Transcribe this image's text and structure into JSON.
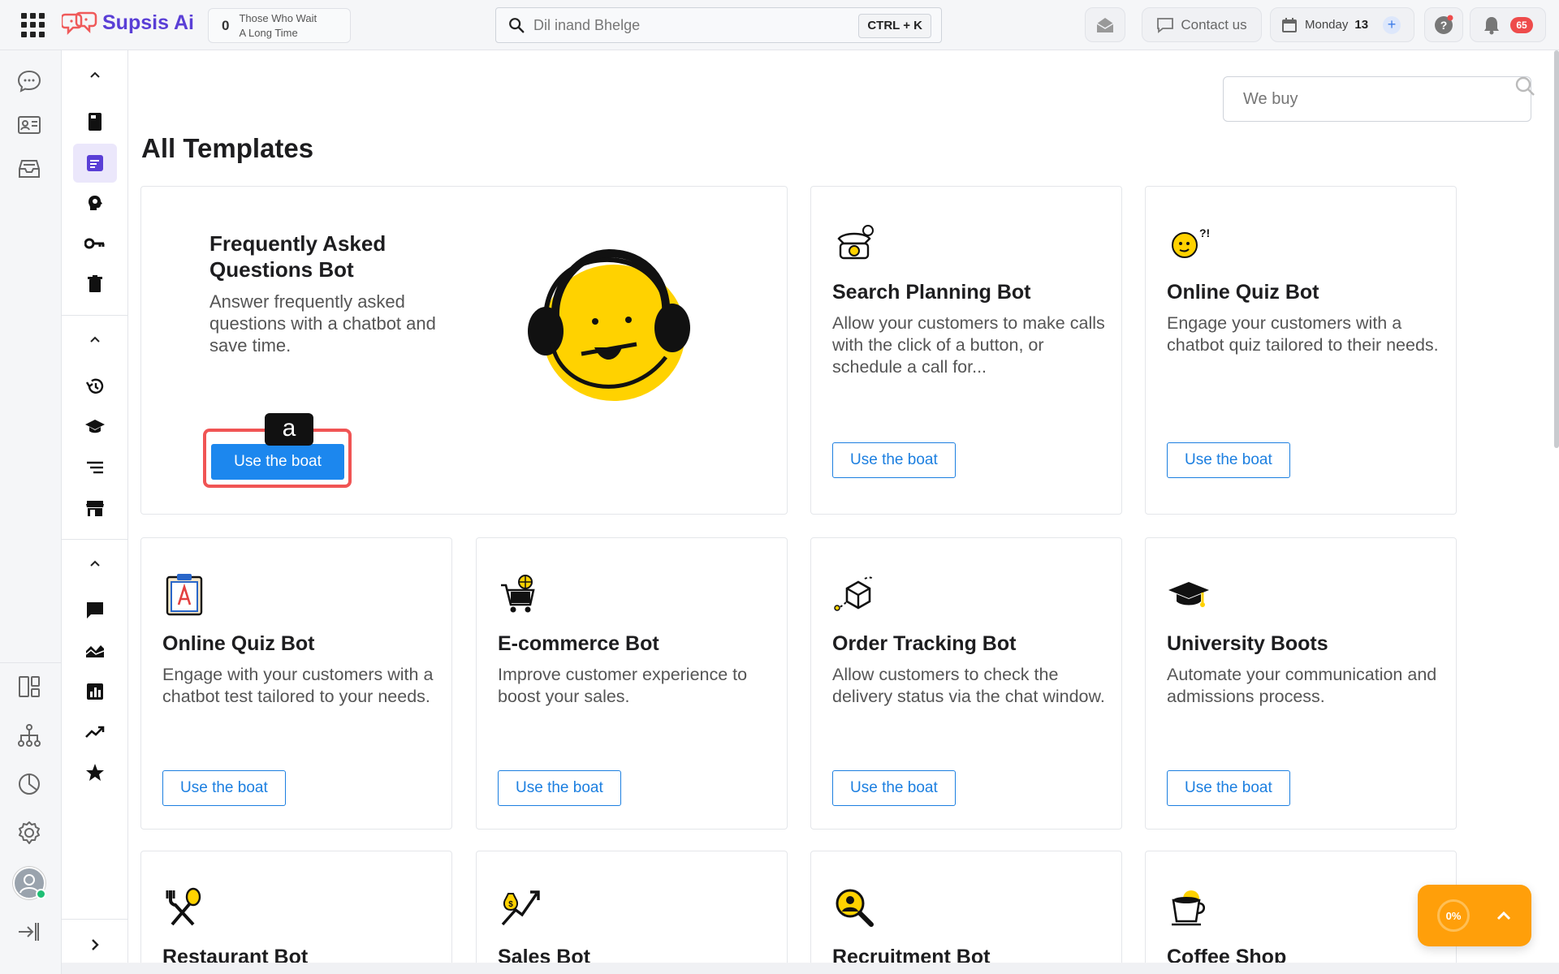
{
  "app": {
    "name": "Supsis Ai"
  },
  "header": {
    "wait_count": "0",
    "wait_line1": "Those Who Wait",
    "wait_line2": "A Long Time",
    "search_value": "Dil inand Bhelge",
    "search_shortcut": "CTRL + K",
    "contact_label": "Contact us",
    "date_day": "Monday",
    "date_num": "13",
    "notifications_count": "65"
  },
  "main": {
    "filter_placeholder": "We buy",
    "title": "All Templates",
    "use_label": "Use the boat",
    "highlight_label": "a",
    "featured": {
      "title": "Frequently Asked Questions Bot",
      "desc": "Answer frequently asked questions with a chatbot and save time."
    },
    "cards": [
      {
        "title": "Search Planning Bot",
        "desc": "Allow your customers to make calls with the click of a button, or schedule a call for..."
      },
      {
        "title": "Online Quiz Bot",
        "desc": "Engage your customers with a chatbot quiz tailored to their needs."
      },
      {
        "title": "Online Quiz Bot",
        "desc": "Engage with your customers with a chatbot test tailored to your needs."
      },
      {
        "title": "E-commerce Bot",
        "desc": "Improve customer experience to boost your sales."
      },
      {
        "title": "Order Tracking Bot",
        "desc": "Allow customers to check the delivery status via the chat window."
      },
      {
        "title": "University Boots",
        "desc": "Automate your communication and admissions process."
      },
      {
        "title": "Restaurant Bot"
      },
      {
        "title": "Sales Bot"
      },
      {
        "title": "Recruitment Bot"
      },
      {
        "title": "Coffee Shop"
      }
    ]
  },
  "widget": {
    "progress": "0%"
  },
  "colors": {
    "brand": "#5a3fd6",
    "primary": "#1c87ee",
    "accent_orange": "#ff9f0a",
    "highlight": "#f05454",
    "emoji_yellow": "#ffd200"
  }
}
